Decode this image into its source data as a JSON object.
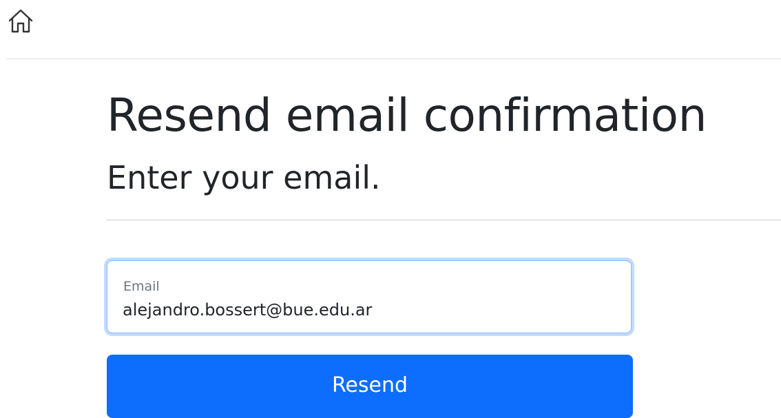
{
  "header": {
    "home_icon": "home-icon"
  },
  "main": {
    "title": "Resend email confirmation",
    "subtitle": "Enter your email."
  },
  "form": {
    "email_label": "Email",
    "email_value": "alejandro.bossert@bue.edu.ar",
    "submit_label": "Resend"
  },
  "colors": {
    "primary": "#0d6efd",
    "focus_border": "#86b7fe",
    "text": "#212529",
    "muted": "#6c757d"
  }
}
